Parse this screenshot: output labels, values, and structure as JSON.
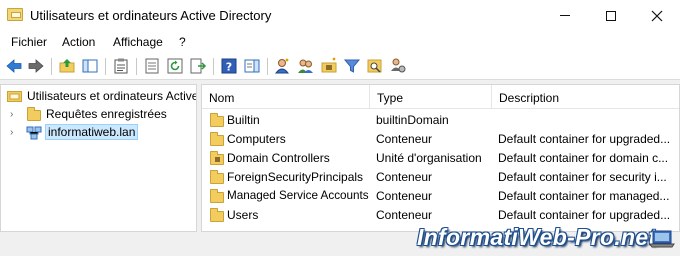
{
  "window": {
    "title": "Utilisateurs et ordinateurs Active Directory"
  },
  "menu": {
    "items": [
      "Fichier",
      "Action",
      "Affichage",
      "?"
    ]
  },
  "tree": {
    "root_label": "Utilisateurs et ordinateurs Active",
    "items": [
      {
        "label": "Requêtes enregistrées",
        "icon": "saved-queries-folder-icon"
      },
      {
        "label": "informatiweb.lan",
        "icon": "domain-icon",
        "selected": true
      }
    ]
  },
  "list": {
    "columns": [
      "Nom",
      "Type",
      "Description"
    ],
    "rows": [
      {
        "name": "Builtin",
        "type": "builtinDomain",
        "description": "",
        "icon": "folder-icon"
      },
      {
        "name": "Computers",
        "type": "Conteneur",
        "description": "Default container for upgraded...",
        "icon": "folder-icon"
      },
      {
        "name": "Domain Controllers",
        "type": "Unité d'organisation",
        "description": "Default container for domain c...",
        "icon": "ou-folder-icon"
      },
      {
        "name": "ForeignSecurityPrincipals",
        "type": "Conteneur",
        "description": "Default container for security i...",
        "icon": "folder-icon"
      },
      {
        "name": "Managed Service Accounts",
        "type": "Conteneur",
        "description": "Default container for managed...",
        "icon": "folder-icon"
      },
      {
        "name": "Users",
        "type": "Conteneur",
        "description": "Default container for upgraded...",
        "icon": "folder-icon"
      }
    ]
  },
  "watermark": {
    "text": "InformatiWeb-Pro.net"
  },
  "colors": {
    "selection": "#cce8ff",
    "folder": "#f2cc5c",
    "watermark_outline": "#1d4e8f"
  }
}
